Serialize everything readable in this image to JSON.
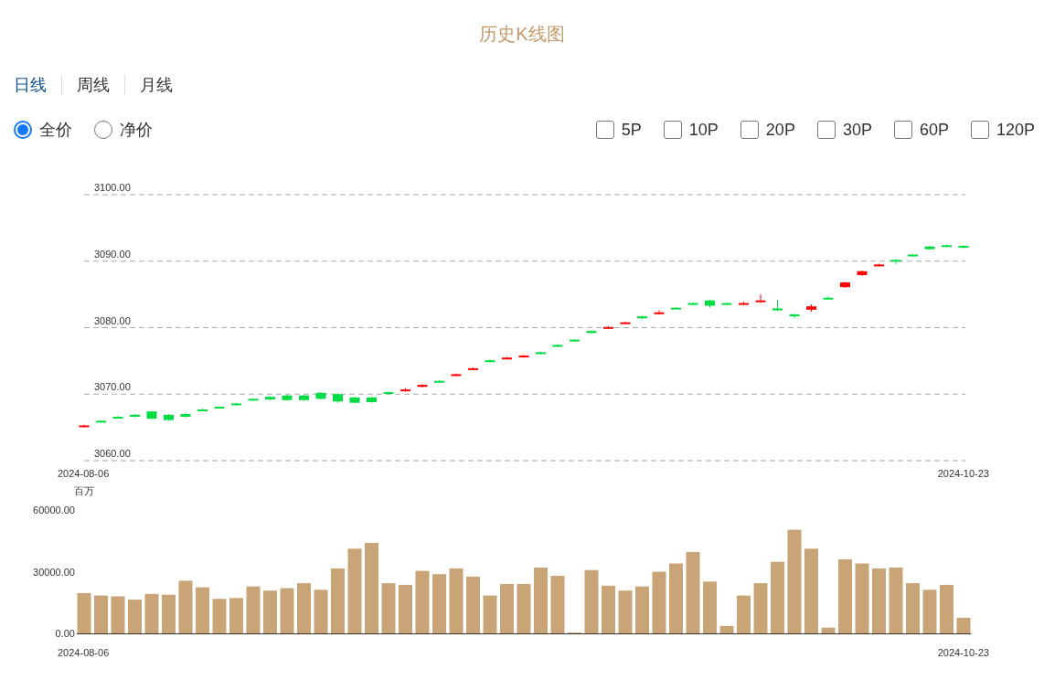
{
  "title": "历史K线图",
  "tabs": [
    {
      "label": "日线",
      "selected": true
    },
    {
      "label": "周线",
      "selected": false
    },
    {
      "label": "月线",
      "selected": false
    }
  ],
  "price_types": [
    {
      "label": "全价",
      "selected": true
    },
    {
      "label": "净价",
      "selected": false
    }
  ],
  "averages": [
    {
      "label": "5P",
      "checked": false
    },
    {
      "label": "10P",
      "checked": false
    },
    {
      "label": "20P",
      "checked": false
    },
    {
      "label": "30P",
      "checked": false
    },
    {
      "label": "60P",
      "checked": false
    },
    {
      "label": "120P",
      "checked": false
    }
  ],
  "kline": {
    "price_labels": [
      "3100.00",
      "3090.00",
      "3080.00",
      "3070.00",
      "3060.00"
    ],
    "start_date": "2024-08-06",
    "end_date": "2024-10-23"
  },
  "volume": {
    "start_date": "2024-08-06",
    "end_date": "2024-10-23",
    "chart_data": {
      "type": "bar",
      "ylabel": "百万",
      "ylim": [
        0,
        60000
      ],
      "grid": false,
      "yticks": [
        {
          "value": 60000,
          "label": "60000.00"
        },
        {
          "value": 30000,
          "label": "30000.00"
        },
        {
          "value": 0,
          "label": "0.00"
        }
      ],
      "series": [
        {
          "color": "#c8a477",
          "values": [
            19600,
            18400,
            18000,
            16400,
            19200,
            18800,
            25600,
            22400,
            16800,
            17200,
            22800,
            20800,
            22000,
            24400,
            21200,
            31600,
            41200,
            44000,
            24400,
            23600,
            30400,
            28800,
            31600,
            27600,
            18400,
            24000,
            24000,
            32000,
            28000,
            400,
            30800,
            23200,
            20800,
            22800,
            30000,
            34000,
            39600,
            25200,
            3600,
            18400,
            24400,
            34800,
            50400,
            41200,
            2800,
            36000,
            34000,
            31600,
            32000,
            24400,
            21200,
            23600,
            7600
          ]
        }
      ]
    }
  }
}
